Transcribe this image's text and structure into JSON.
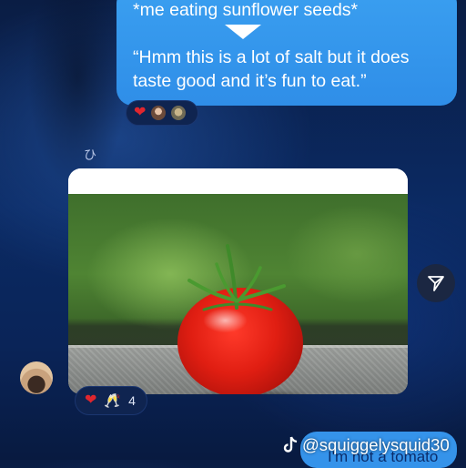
{
  "message_sent": {
    "line1": "*me eating sunflower seeds*",
    "line2": "“Hmm this is a lot of salt but it does taste good and it’s fun to eat.”"
  },
  "reactions_top": {
    "icons": [
      "heart-icon",
      "avatar",
      "avatar"
    ]
  },
  "glyph_label": "ひ",
  "photo_message": {
    "subject": "tomato-photo"
  },
  "reactions_bottom": {
    "icons": [
      "heart-icon",
      "cheers-icon"
    ],
    "count": "4"
  },
  "message_bottom": {
    "text": "I'm not a tomato"
  },
  "watermark": {
    "handle": "@squiggelysquid30"
  },
  "colors": {
    "bubble_blue": "#3593ea",
    "background": "#0b2a63",
    "heart": "#e0262e"
  }
}
